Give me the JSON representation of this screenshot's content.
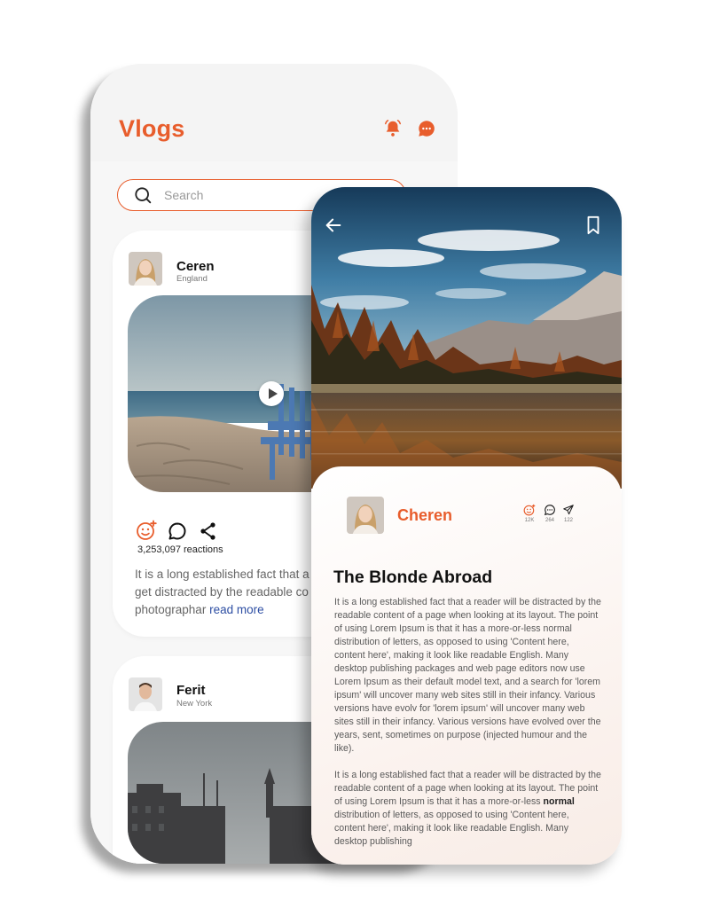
{
  "vlogs_screen": {
    "title": "Vlogs",
    "icons": {
      "notifications": "bell-icon",
      "messages": "chat-bubble-icon"
    },
    "search": {
      "placeholder": "Search",
      "value": ""
    },
    "posts": [
      {
        "author": "Ceren",
        "location": "England",
        "reactions": "3,253,097 reactions",
        "text_lines": [
          "It is a long established fact that a",
          "get distracted by the readable co",
          "photographar"
        ],
        "read_more": "read more"
      },
      {
        "author": "Ferit",
        "location": "New York"
      }
    ]
  },
  "detail_screen": {
    "author": "Cheren",
    "stats": {
      "reactions": "12K",
      "comments": "264",
      "shares": "122"
    },
    "title": "The Blonde Abroad",
    "paragraph1": "It is a long established fact that a reader will be distracted by the readable content of a page when looking at its layout. The point of using Lorem Ipsum is that it has a more-or-less normal distribution of letters, as opposed to using 'Content here, content here', making it look like readable English. Many desktop publishing packages and web page editors now use Lorem Ipsum as their default model text, and a search for 'lorem ipsum' will uncover many web sites still in their infancy. Various versions have evolv for 'lorem ipsum' will uncover many web sites still in their infancy. Various versions have evolved over the years, sent, sometimes on purpose (injected humour and the like).",
    "paragraph2_before": "It is a long established fact that a reader will be distracted by the readable content of a page when looking at its layout. The point of using Lorem Ipsum is that it has a more-or-less ",
    "paragraph2_bold": "normal",
    "paragraph2_after": " distribution of letters, as opposed to using 'Content here, content here', making it look like readable English. Many desktop publishing"
  },
  "colors": {
    "accent": "#e85d2c",
    "link": "#2d4ea3"
  }
}
